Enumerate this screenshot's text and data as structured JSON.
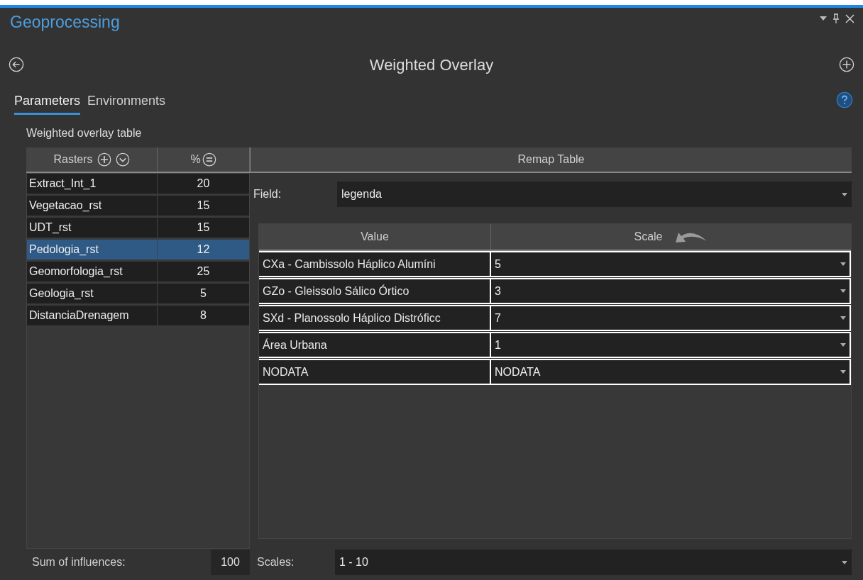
{
  "panel": {
    "title": "Geoprocessing"
  },
  "tool": {
    "title": "Weighted Overlay"
  },
  "tabs": [
    {
      "label": "Parameters",
      "selected": true
    },
    {
      "label": "Environments",
      "selected": false
    }
  ],
  "section_label": "Weighted overlay table",
  "rasters": {
    "columns": [
      "Rasters",
      "%"
    ],
    "rows": [
      {
        "name": "Extract_Int_1",
        "influence": "20",
        "selected": false
      },
      {
        "name": "Vegetacao_rst",
        "influence": "15",
        "selected": false
      },
      {
        "name": "UDT_rst",
        "influence": "15",
        "selected": false
      },
      {
        "name": "Pedologia_rst",
        "influence": "12",
        "selected": true
      },
      {
        "name": "Geomorfologia_rst",
        "influence": "25",
        "selected": false
      },
      {
        "name": "Geologia_rst",
        "influence": "5",
        "selected": false
      },
      {
        "name": "DistanciaDrenagem",
        "influence": "8",
        "selected": false
      }
    ]
  },
  "remap": {
    "title": "Remap Table",
    "field": {
      "label": "Field:",
      "value": "legenda"
    },
    "columns": [
      "Value",
      "Scale"
    ],
    "rows": [
      {
        "value": "CXa - Cambissolo Háplico Alumíni",
        "scale": "5"
      },
      {
        "value": "GZo - Gleissolo Sálico Órtico",
        "scale": "3"
      },
      {
        "value": "SXd - Planossolo Háplico Distróficc",
        "scale": "7"
      },
      {
        "value": "Área Urbana",
        "scale": "1"
      },
      {
        "value": "NODATA",
        "scale": "NODATA"
      }
    ]
  },
  "footer": {
    "sum_label": "Sum of influences:",
    "sum_value": "100",
    "scales_label": "Scales:",
    "scales_value": "1 - 10"
  }
}
